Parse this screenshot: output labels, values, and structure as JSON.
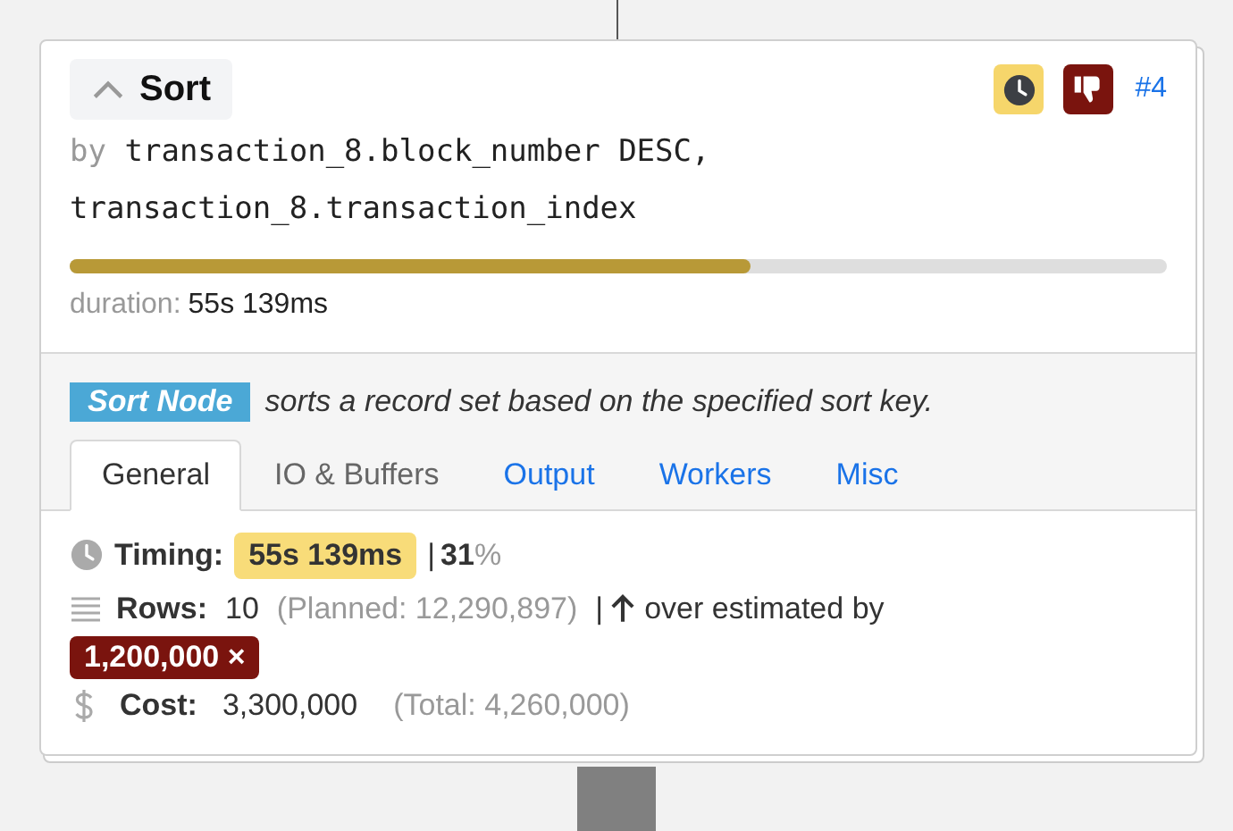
{
  "header": {
    "title": "Sort",
    "expanded": true,
    "node_id": "#4"
  },
  "sort_key": {
    "prefix": "by",
    "text": "transaction_8.block_number DESC, transaction_8.transaction_index"
  },
  "progress": {
    "level": 0.62
  },
  "duration": {
    "label": "duration:",
    "value": "55s 139ms"
  },
  "description": {
    "tag": "Sort Node",
    "text": "sorts a record set based on the specified sort key."
  },
  "tabs": [
    {
      "label": "General",
      "selected": true,
      "disabled": false
    },
    {
      "label": "IO & Buffers",
      "selected": false,
      "disabled": true
    },
    {
      "label": "Output",
      "selected": false,
      "disabled": false
    },
    {
      "label": "Workers",
      "selected": false,
      "disabled": false
    },
    {
      "label": "Misc",
      "selected": false,
      "disabled": false
    }
  ],
  "timing": {
    "label": "Timing:",
    "value": "55s 139ms",
    "separator": "|",
    "percent": "31",
    "percent_sign": "%"
  },
  "rows": {
    "label": "Rows:",
    "value": "10",
    "planned": "(Planned: 12,290,897)",
    "separator": "|",
    "estimate": "over estimated by",
    "factor": "1,200,000 ×"
  },
  "cost": {
    "label": "Cost:",
    "value": "3,300,000",
    "total": "(Total: 4,260,000)"
  }
}
